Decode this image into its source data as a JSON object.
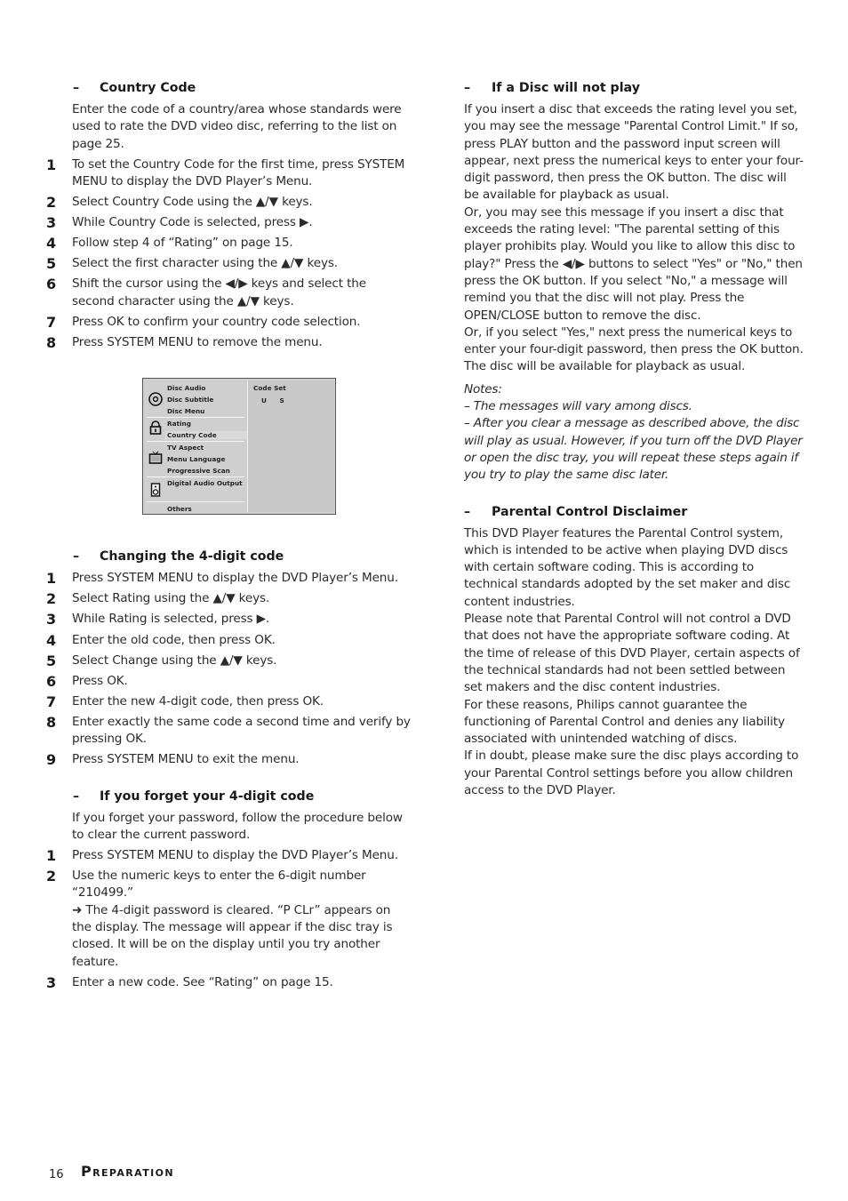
{
  "left": {
    "country_code": {
      "heading": "Country Code",
      "intro": "Enter the code of a country/area whose standards were used to rate the DVD video disc, referring to the list  on page 25.",
      "steps": [
        {
          "num": "1",
          "text": "To set the Country Code for the first time, press SYSTEM MENU to display the DVD Player’s Menu."
        },
        {
          "num": "2",
          "text": "Select Country Code using the ▲/▼ keys."
        },
        {
          "num": "3",
          "text": "While Country Code is selected, press ▶."
        },
        {
          "num": "4",
          "text": "Follow step 4 of “Rating” on page 15."
        },
        {
          "num": "5",
          "text": "Select the first character using the ▲/▼ keys."
        },
        {
          "num": "6",
          "text": "Shift the cursor using the ◀/▶ keys and select the second character using the ▲/▼ keys."
        },
        {
          "num": "7",
          "text": "Press OK to confirm your country code selection."
        },
        {
          "num": "8",
          "text": "Press SYSTEM MENU to remove the menu."
        }
      ]
    },
    "menu_figure": {
      "items": [
        "Disc Audio",
        "Disc Subtitle",
        "Disc Menu",
        "Rating",
        "Country Code",
        "TV Aspect",
        "Menu Language",
        "Progressive Scan",
        "Digital Audio Output",
        "Others"
      ],
      "selected": "Country Code",
      "icons": [
        "disc-icon",
        "lock-icon",
        "tv-icon",
        "speaker-icon"
      ],
      "right_title": "Code Set",
      "right_value": "U S"
    },
    "change_code": {
      "heading": "Changing the 4-digit code",
      "steps": [
        {
          "num": "1",
          "text": "Press SYSTEM MENU to display the DVD Player’s Menu."
        },
        {
          "num": "2",
          "text": "Select Rating using the ▲/▼ keys."
        },
        {
          "num": "3",
          "text": "While Rating is selected, press ▶."
        },
        {
          "num": "4",
          "text": "Enter the old code, then press OK."
        },
        {
          "num": "5",
          "text": "Select Change using the ▲/▼ keys."
        },
        {
          "num": "6",
          "text": "Press OK."
        },
        {
          "num": "7",
          "text": "Enter the new 4-digit code, then press OK."
        },
        {
          "num": "8",
          "text": "Enter exactly the same code a second time and verify by pressing OK."
        },
        {
          "num": "9",
          "text": "Press SYSTEM MENU to exit the menu."
        }
      ]
    },
    "forget_code": {
      "heading": "If you forget your 4-digit code",
      "intro": "If you forget your password, follow the procedure below to clear the current password.",
      "steps": [
        {
          "num": "1",
          "text": "Press SYSTEM MENU to display the DVD Player’s Menu."
        },
        {
          "num": "2",
          "text": "Use the numeric keys to enter the 6-digit number “210499.”",
          "result": "➜ The 4-digit password is cleared. “P CLr” appears on the display. The message will appear if the disc tray is closed. It will be on the display until you try another feature."
        },
        {
          "num": "3",
          "text": "Enter a new code. See “Rating” on page 15."
        }
      ]
    }
  },
  "right": {
    "disc_not_play": {
      "heading": "If a Disc will not play",
      "paragraphs": [
        "If you insert a disc that exceeds the rating level you set, you may see the message \"Parental Control Limit.\"  If so, press PLAY button and the password input screen will appear, next press the numerical keys to enter your four-digit password, then press the OK button. The disc will be available for playback as usual.",
        "Or, you may see this message if you insert a disc that exceeds the rating level: \"The parental setting of this player prohibits play. Would you like to allow this disc to play?\" Press the ◀/▶ buttons to select \"Yes\" or \"No,\"  then press the OK button. If you select \"No,\" a message will remind you that the disc will not play. Press the OPEN/CLOSE button to remove the disc.",
        "Or, if you select \"Yes,\" next press the numerical keys to enter your four-digit password, then press the OK button. The disc will be available for playback as usual."
      ],
      "notes_title": "Notes:",
      "notes": [
        "–  The messages will vary among discs.",
        "–  After you clear a message as described above, the disc will play as usual. However, if you turn off the DVD Player or open the disc tray, you will repeat these steps again if you try to play the same disc later."
      ]
    },
    "disclaimer": {
      "heading": "Parental Control Disclaimer",
      "paragraphs": [
        "This DVD Player features the Parental Control system, which is intended to be active when playing DVD discs with certain software coding. This is according to technical standards adopted by the set maker and disc content industries.",
        "Please note that Parental Control will not control a DVD that does not have the appropriate software coding. At the time of release of this DVD Player, certain aspects of the technical standards had not been settled between set makers and the disc content industries.",
        "For these reasons, Philips cannot guarantee the functioning of Parental Control and denies any liability associated with unintended watching of discs.",
        "If in doubt, please make sure the disc plays according to your Parental Control settings before you allow children access to the DVD Player."
      ]
    }
  },
  "footer": {
    "page_number": "16",
    "section": "Preparation"
  },
  "dash": "–"
}
